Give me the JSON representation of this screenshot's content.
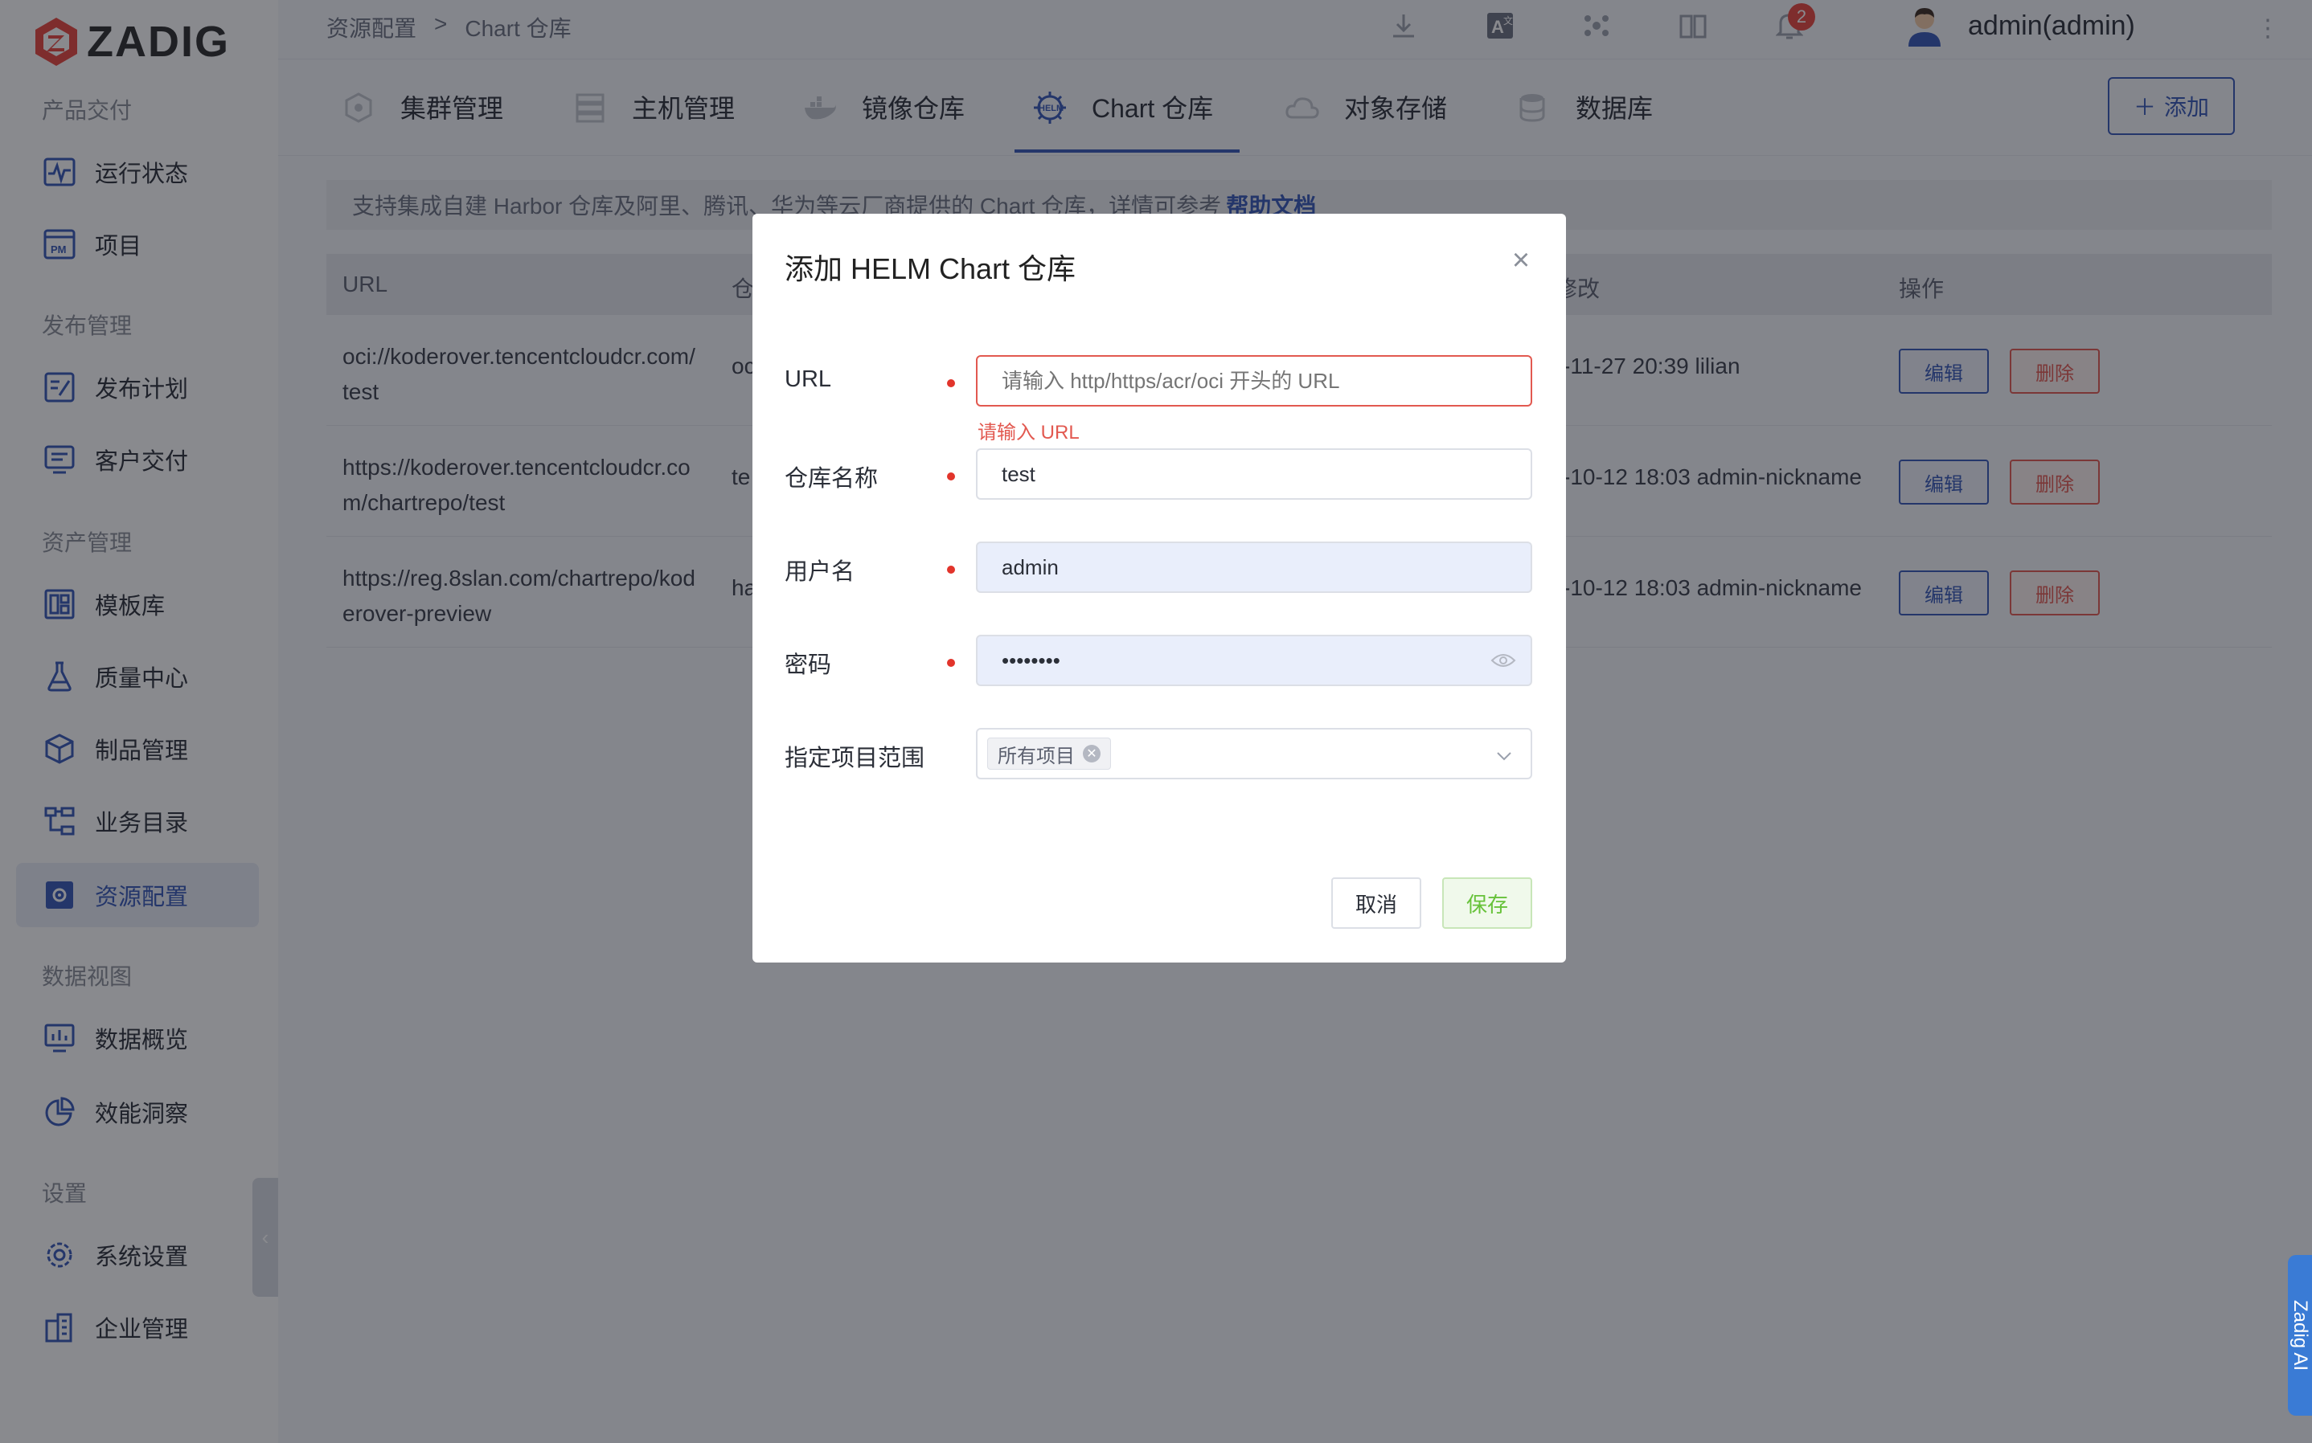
{
  "brand": {
    "name": "ZADIG",
    "color": "#e8453c",
    "accent": "#3557b7"
  },
  "sidebar": {
    "sections": [
      {
        "title": "产品交付",
        "items": [
          {
            "label": "运行状态",
            "icon": "activity-icon"
          },
          {
            "label": "项目",
            "icon": "project-pm-icon"
          }
        ]
      },
      {
        "title": "发布管理",
        "items": [
          {
            "label": "发布计划",
            "icon": "release-plan-icon"
          },
          {
            "label": "客户交付",
            "icon": "delivery-icon"
          }
        ]
      },
      {
        "title": "资产管理",
        "items": [
          {
            "label": "模板库",
            "icon": "template-icon"
          },
          {
            "label": "质量中心",
            "icon": "flask-icon"
          },
          {
            "label": "制品管理",
            "icon": "package-icon"
          },
          {
            "label": "业务目录",
            "icon": "catalog-icon"
          },
          {
            "label": "资源配置",
            "icon": "resource-gear-icon",
            "active": true
          }
        ]
      },
      {
        "title": "数据视图",
        "items": [
          {
            "label": "数据概览",
            "icon": "dashboard-icon"
          },
          {
            "label": "效能洞察",
            "icon": "pie-chart-icon"
          }
        ]
      },
      {
        "title": "设置",
        "items": [
          {
            "label": "系统设置",
            "icon": "settings-icon"
          },
          {
            "label": "企业管理",
            "icon": "enterprise-icon"
          }
        ]
      }
    ]
  },
  "header": {
    "breadcrumb": [
      "资源配置",
      ">",
      "Chart 仓库"
    ],
    "notification_count": "2",
    "user": "admin(admin)"
  },
  "tabs": [
    {
      "label": "集群管理",
      "icon": "k8s-wheel-icon"
    },
    {
      "label": "主机管理",
      "icon": "server-icon"
    },
    {
      "label": "镜像仓库",
      "icon": "docker-icon"
    },
    {
      "label": "Chart 仓库",
      "icon": "helm-icon",
      "active": true
    },
    {
      "label": "对象存储",
      "icon": "cloud-icon"
    },
    {
      "label": "数据库",
      "icon": "database-icon"
    }
  ],
  "add_button": "添加",
  "info_bar": {
    "text": "支持集成自建 Harbor 仓库及阿里、腾讯、华为等云厂商提供的 Chart 仓库，详情可参考",
    "link": "帮助文档"
  },
  "table": {
    "headers": [
      "URL",
      "仓",
      "修改",
      "操作"
    ],
    "rows": [
      {
        "url": "oci://koderover.tencentcloudcr.com/test",
        "name": "oc",
        "modified": "-11-27 20:39 lilian"
      },
      {
        "url": "https://koderover.tencentcloudcr.com/chartrepo/test",
        "name": "te",
        "modified": "-10-12 18:03 admin-nickname"
      },
      {
        "url": "https://reg.8slan.com/chartrepo/koderover-preview",
        "name": "ha",
        "modified": "-10-12 18:03 admin-nickname"
      }
    ],
    "edit_label": "编辑",
    "delete_label": "删除"
  },
  "dialog": {
    "title": "添加 HELM Chart 仓库",
    "fields": {
      "url": {
        "label": "URL",
        "placeholder": "请输入 http/https/acr/oci 开头的 URL",
        "error": "请输入 URL"
      },
      "repo_name": {
        "label": "仓库名称",
        "value": "test"
      },
      "username": {
        "label": "用户名",
        "value": "admin"
      },
      "password": {
        "label": "密码",
        "value": "••••••••"
      },
      "scope": {
        "label": "指定项目范围",
        "tag": "所有项目"
      }
    },
    "cancel": "取消",
    "save": "保存"
  },
  "assistant_tab": "Zadig AI"
}
